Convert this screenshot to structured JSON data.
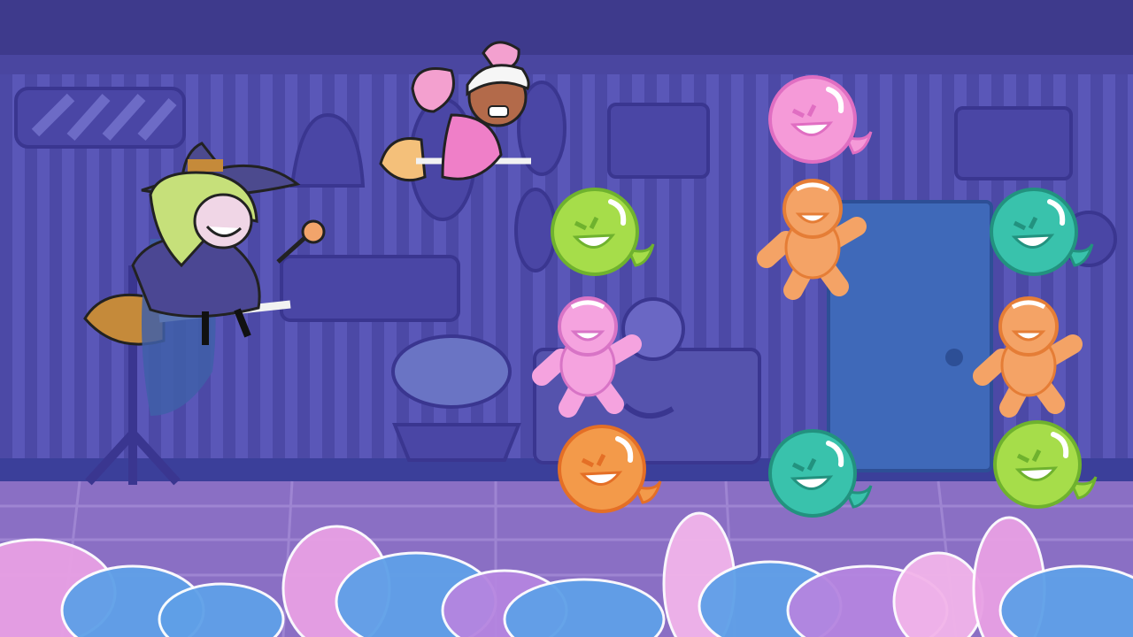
{
  "scene": {
    "name": "haunted-candy-house-level",
    "palette": {
      "ceiling": "#3e3a8c",
      "wall": "#5a57b8",
      "wall_stripe": "#4c49a6",
      "baseboard": "#3b3f9a",
      "floor": "#8a6fc4",
      "floor_light": "#a58ad6",
      "door": "#3f69b9",
      "outline": "#2b2870"
    }
  },
  "player": {
    "character": "witch-on-broom",
    "hair_color": "#c6e07a",
    "hat_color": "#4c4a8e",
    "robe_color": "#4b4793"
  },
  "ally": {
    "character": "pink-haired-girl-on-broom",
    "hair_color": "#f3a0cf",
    "dress_color": "#ef7fc8"
  },
  "enemies": [
    {
      "type": "ghost-blob",
      "color": "#f59ad8",
      "shade": "#e06ec2"
    },
    {
      "type": "ghost-blob",
      "color": "#a6dd4a",
      "shade": "#6fb22e"
    },
    {
      "type": "gingerbread",
      "color": "#f4a366",
      "shade": "#e57d36"
    },
    {
      "type": "ghost-blob",
      "color": "#39c2ac",
      "shade": "#22927f"
    },
    {
      "type": "gingerbread",
      "color": "#f5a3df",
      "shade": "#d874c6"
    },
    {
      "type": "gingerbread",
      "color": "#f4a366",
      "shade": "#e57d36"
    },
    {
      "type": "ghost-blob",
      "color": "#f39a4a",
      "shade": "#e46f26"
    },
    {
      "type": "ghost-blob",
      "color": "#39c2ac",
      "shade": "#22927f"
    },
    {
      "type": "ghost-blob",
      "color": "#a6dd4a",
      "shade": "#6fb22e"
    }
  ],
  "foreground": {
    "candy_pile_colors": [
      "#5fa0e8",
      "#e8a0e4",
      "#b585e0",
      "#f2b4ea"
    ]
  }
}
